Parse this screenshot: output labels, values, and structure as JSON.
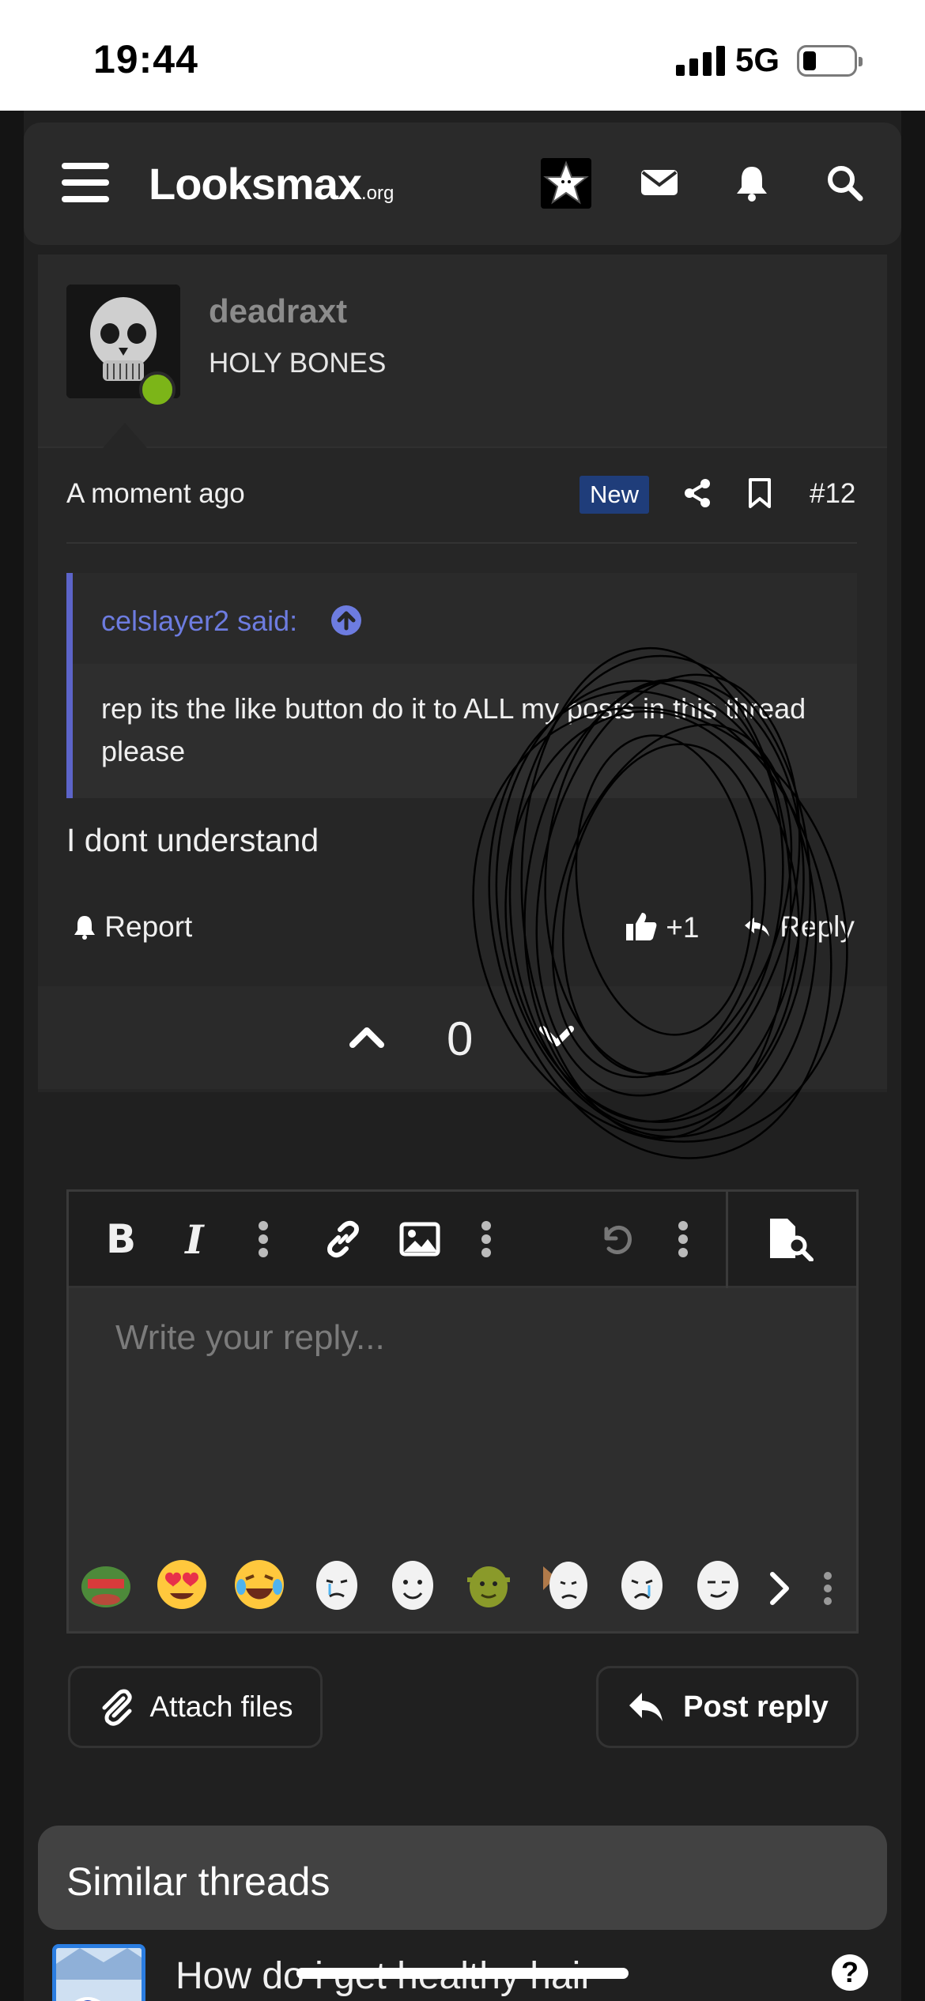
{
  "status_bar": {
    "time": "19:44",
    "network": "5G"
  },
  "header": {
    "logo_main": "Looksmax",
    "logo_suffix": ".org",
    "icons": [
      "menu-icon",
      "star-avatar",
      "mail-icon",
      "bell-icon",
      "search-icon"
    ]
  },
  "post": {
    "username": "deadraxt",
    "user_title": "HOLY BONES",
    "time": "A moment ago",
    "badge": "New",
    "post_number": "#12",
    "quote": {
      "author": "celslayer2 said:",
      "text": "rep its the like button do it to ALL my posts in this thread please"
    },
    "message": "I dont understand",
    "actions": {
      "report": "Report",
      "likes": "+1",
      "reply": "Reply"
    },
    "vote_count": "0"
  },
  "editor": {
    "placeholder": "Write your reply...",
    "toolbar": [
      "bold-icon",
      "italic-icon",
      "more-icon",
      "link-icon",
      "image-icon",
      "more-icon",
      "undo-icon",
      "more-icon",
      "preview-icon"
    ],
    "toolbar_labels": {
      "bold": "B",
      "italic": "I"
    },
    "emojis": [
      "pepe-angry",
      "heart-eyes",
      "crying-laughing",
      "wojak-crying",
      "wojak-smile",
      "shrek",
      "wojak-cat",
      "wojak-crying-2",
      "wojak-smug"
    ]
  },
  "buttons": {
    "attach": "Attach files",
    "post_reply": "Post reply"
  },
  "similar": {
    "title": "Similar threads",
    "first_thread": "How do i get healthy hair"
  },
  "colors": {
    "background": "#141414",
    "card": "#262626",
    "accent_quote": "#5c64c9",
    "badge_new": "#1f3d7a",
    "online": "#7cb518"
  }
}
